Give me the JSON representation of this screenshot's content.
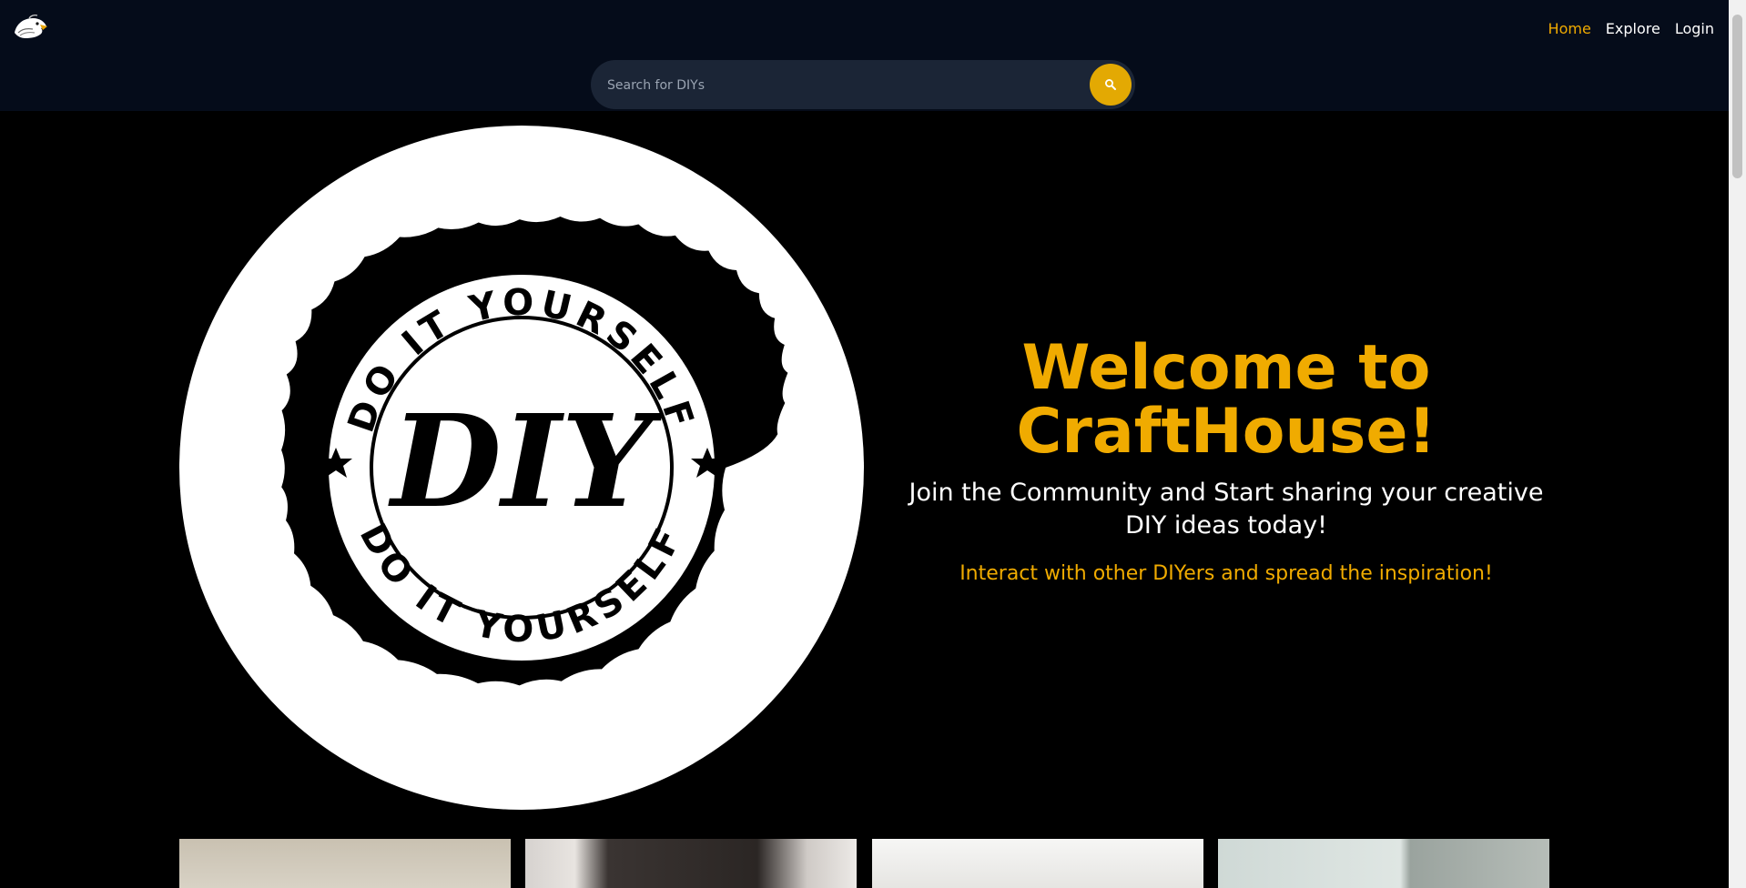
{
  "header": {
    "logo_icon": "eagle-logo-icon",
    "nav": [
      {
        "label": "Home",
        "active": true
      },
      {
        "label": "Explore",
        "active": false
      },
      {
        "label": "Login",
        "active": false
      }
    ],
    "search": {
      "placeholder": "Search for DIYs",
      "button_icon": "search-icon"
    }
  },
  "hero": {
    "badge": {
      "top_arc_text": "DO IT YOURSELF",
      "bottom_arc_text": "DO IT YOURSELF",
      "center_text": "DIY"
    },
    "title": "Welcome to CraftHouse!",
    "subtitle": "Join the Community and Start sharing your creative DIY ideas today!",
    "tagline": "Interact with other DIYers and spread the inspiration!"
  },
  "colors": {
    "accent": "#f0ab00",
    "header_bg": "#050c1a",
    "search_bg": "#1b2536",
    "page_bg": "#000000"
  }
}
